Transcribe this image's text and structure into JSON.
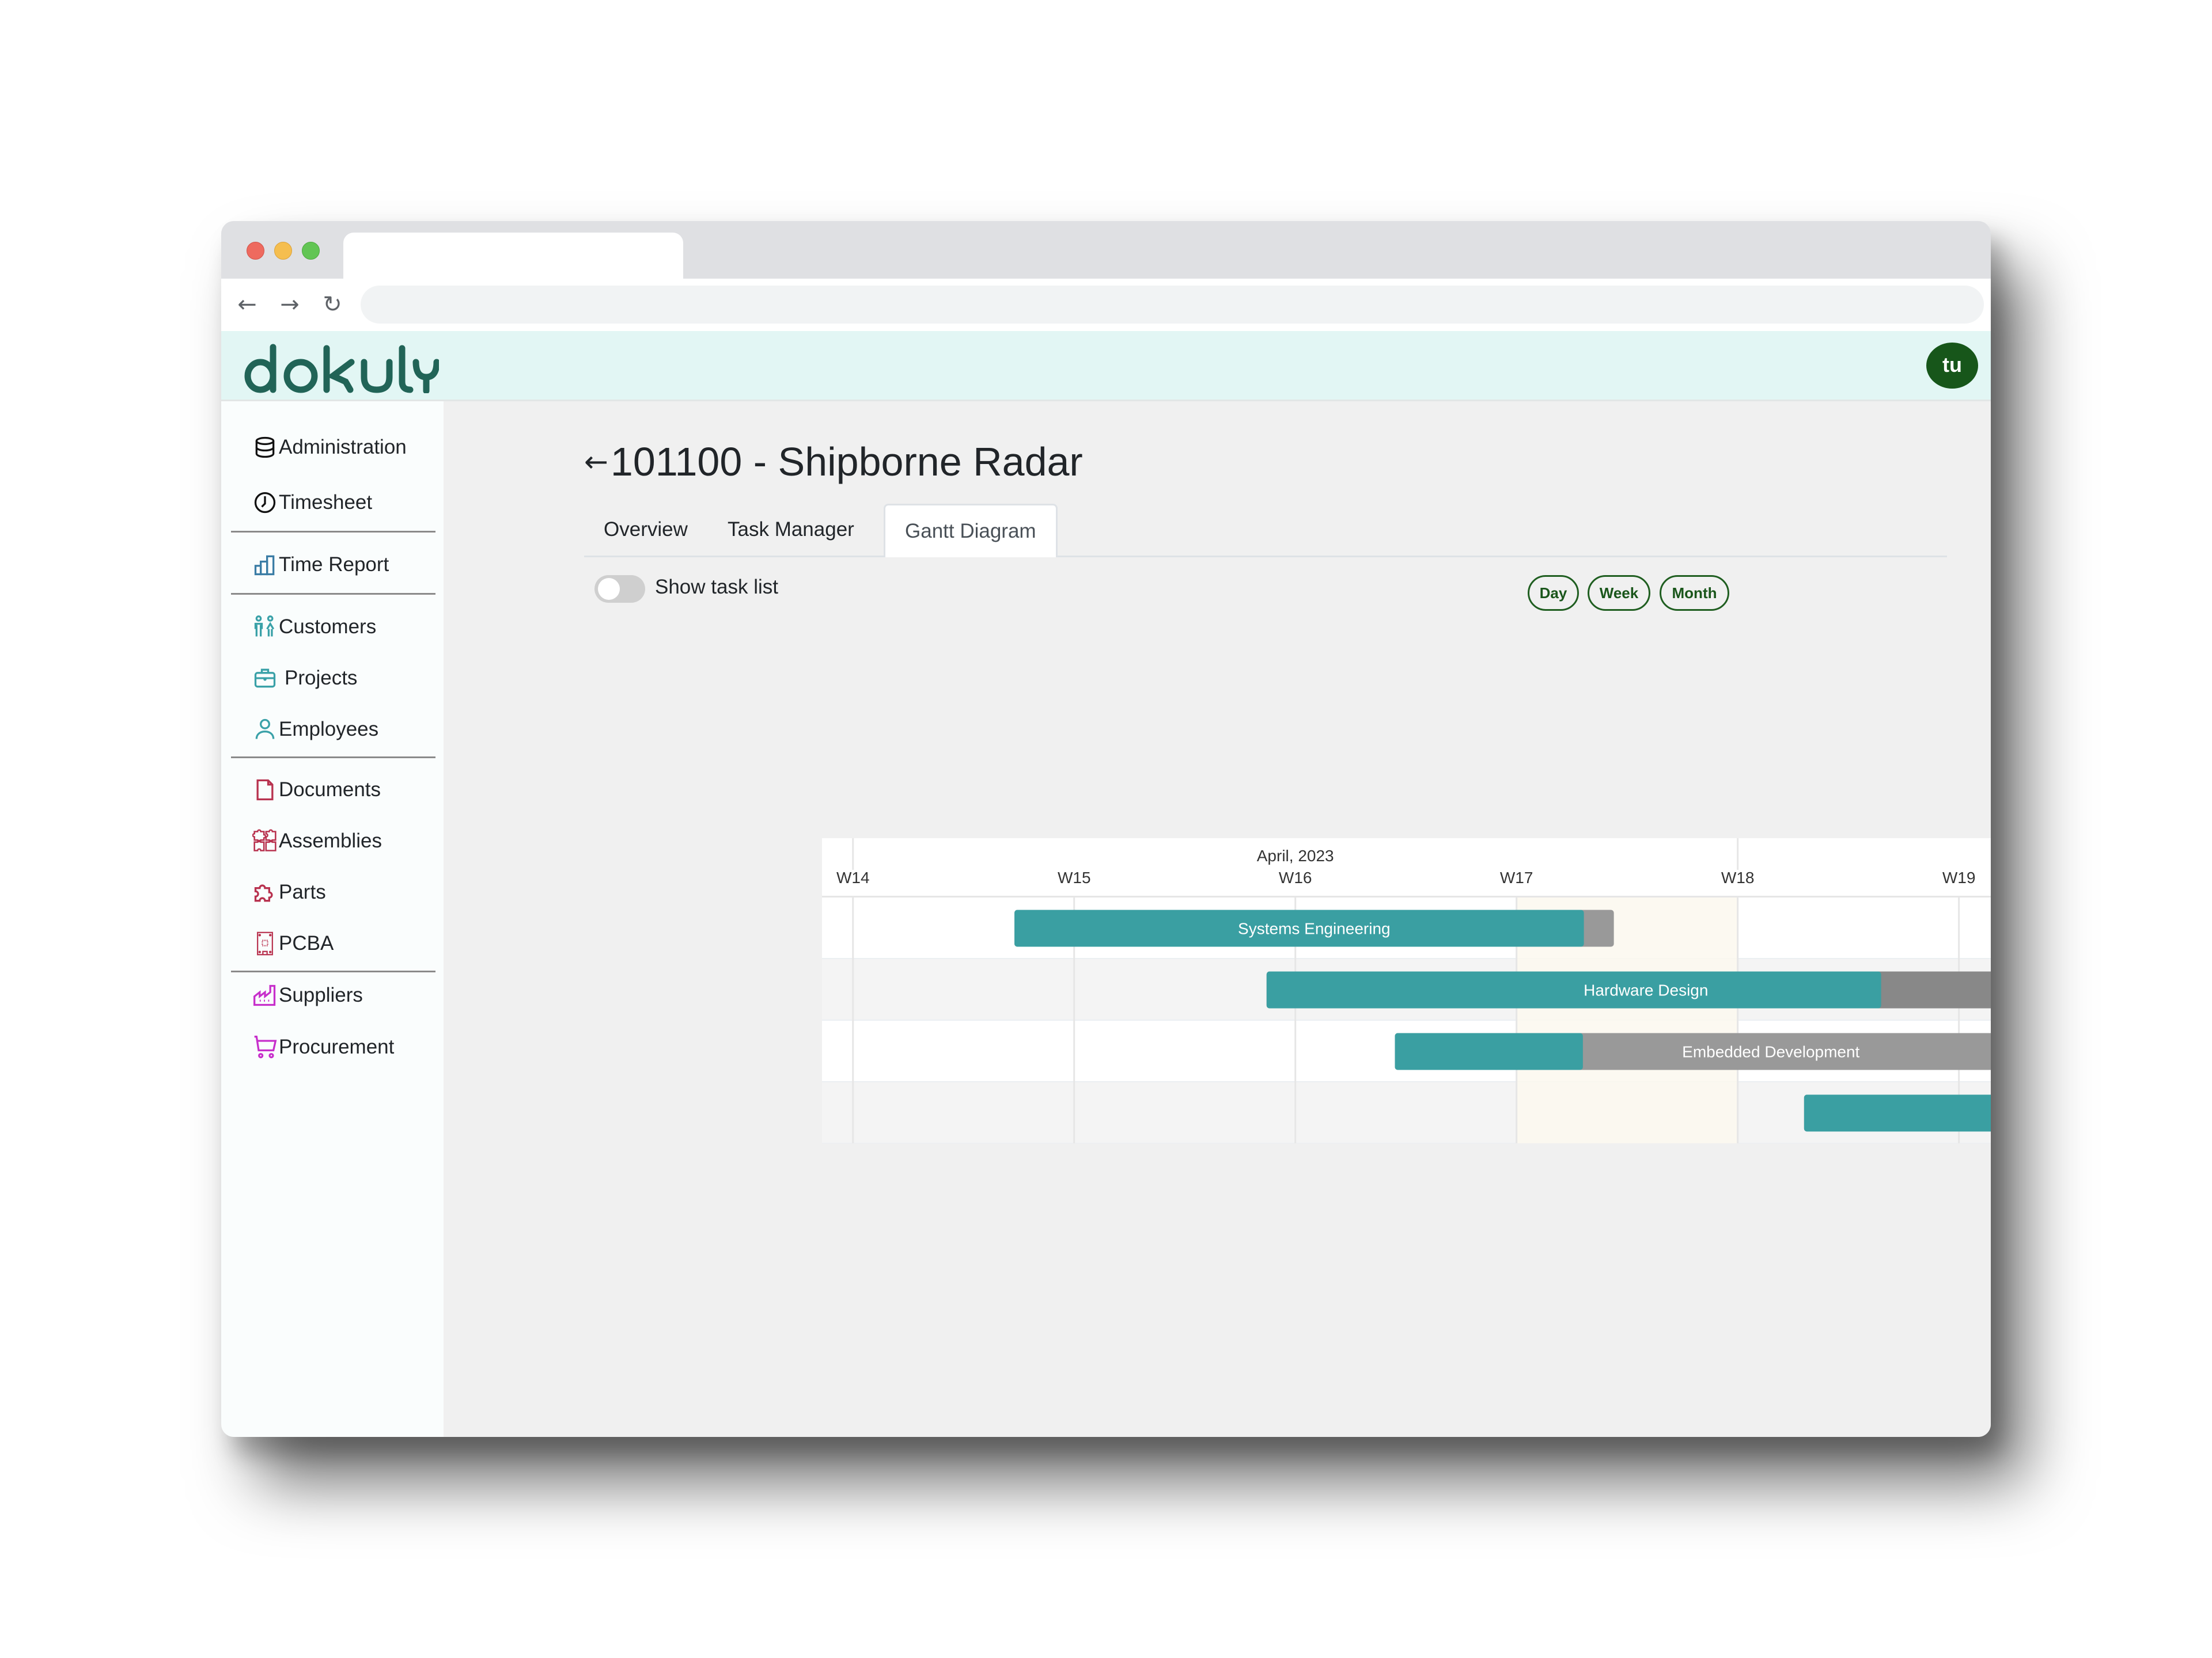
{
  "browser": {
    "back_icon": "arrow-left-icon",
    "forward_icon": "arrow-right-icon",
    "reload_icon": "reload-icon",
    "url": ""
  },
  "app": {
    "logo_text": "dokuly",
    "brand_color": "#216457",
    "avatar_initials": "tu",
    "avatar_color": "#17561a"
  },
  "sidebar": {
    "items": [
      {
        "label": "Administration",
        "icon": "database-icon",
        "color": "#111111"
      },
      {
        "label": "Timesheet",
        "icon": "clock-icon",
        "color": "#111111"
      },
      {
        "label": "Time Report",
        "icon": "bar-chart-icon",
        "color": "#3a7ca5"
      },
      {
        "label": "Customers",
        "icon": "people-icon",
        "color": "#3aa1a8"
      },
      {
        "label": "Projects",
        "icon": "briefcase-icon",
        "color": "#3aa1a8"
      },
      {
        "label": "Employees",
        "icon": "user-icon",
        "color": "#3aa1a8"
      },
      {
        "label": "Documents",
        "icon": "document-icon",
        "color": "#b8324f"
      },
      {
        "label": "Assemblies",
        "icon": "puzzle-pieces-icon",
        "color": "#b8324f"
      },
      {
        "label": "Parts",
        "icon": "puzzle-icon",
        "color": "#b8324f"
      },
      {
        "label": "PCBA",
        "icon": "circuit-board-icon",
        "color": "#b8324f"
      },
      {
        "label": "Suppliers",
        "icon": "factory-icon",
        "color": "#c72fcb"
      },
      {
        "label": "Procurement",
        "icon": "cart-icon",
        "color": "#c72fcb"
      }
    ]
  },
  "page": {
    "back_icon": "arrow-left-icon",
    "title": "101100 - Shipborne Radar",
    "tabs": [
      {
        "label": "Overview",
        "active": false
      },
      {
        "label": "Task Manager",
        "active": false
      },
      {
        "label": "Gantt Diagram",
        "active": true
      }
    ],
    "show_task_list": {
      "label": "Show task list",
      "checked": false
    },
    "view_modes": [
      "Day",
      "Week",
      "Month"
    ]
  },
  "chart_data": {
    "type": "gantt",
    "title": "",
    "month_label": "April, 2023",
    "x_ticks": [
      "W14",
      "W15",
      "W16",
      "W17",
      "W18",
      "W19"
    ],
    "x_unit": "week",
    "x_range": [
      13.86,
      19.85
    ],
    "highlight_week": "W17",
    "colors": {
      "progress": "#3a9fa2",
      "remaining": "#999999",
      "remaining_selected": "#888888",
      "highlight": "#fbf8ef"
    },
    "tasks": [
      {
        "name": "Systems Engineering",
        "start": 14.73,
        "end": 17.44,
        "progress": 0.95,
        "label_visible": true
      },
      {
        "name": "Hardware Design",
        "start": 15.87,
        "end": 19.3,
        "progress": 0.81,
        "label_visible": true
      },
      {
        "name": "Embedded Development",
        "start": 16.45,
        "end": 19.85,
        "progress": 0.25,
        "label_visible": true
      },
      {
        "name": "",
        "start": 18.3,
        "end": 19.85,
        "progress": 1.0,
        "label_visible": false
      }
    ]
  }
}
